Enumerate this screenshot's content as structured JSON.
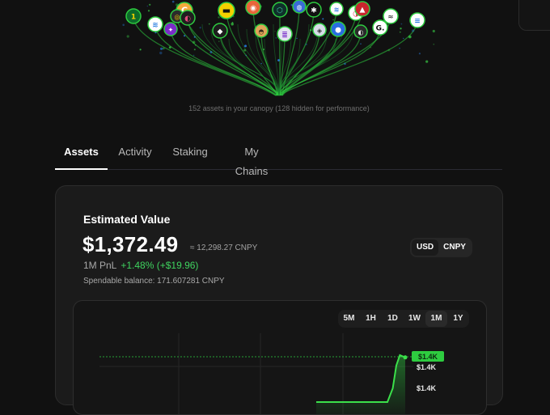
{
  "canopy": {
    "caption": "152 assets in your canopy (128 hidden for performance)",
    "accent_color": "#2ecc40",
    "tokens": [
      {
        "name": "token-icon-1",
        "glyph": "1",
        "bg": "#0d6b2a",
        "fg": "#f5d000"
      },
      {
        "name": "token-icon-2",
        "glyph": "≋",
        "bg": "#ffffff",
        "fg": "#2a7de1"
      },
      {
        "name": "token-icon-3",
        "glyph": "C",
        "bg": "#f2a93b",
        "fg": "#ffffff"
      },
      {
        "name": "token-icon-4",
        "glyph": "◎",
        "bg": "#2b2b2b",
        "fg": "#f7c600"
      },
      {
        "name": "token-icon-5",
        "glyph": "◐",
        "bg": "#1f1f1f",
        "fg": "#e04b7a"
      },
      {
        "name": "token-icon-6",
        "glyph": "✦",
        "bg": "#7b2cc9",
        "fg": "#ffffff"
      },
      {
        "name": "token-icon-7",
        "glyph": "▬",
        "bg": "#f5d000",
        "fg": "#111111"
      },
      {
        "name": "token-icon-8",
        "glyph": "◉",
        "bg": "#e8663a",
        "fg": "#ffffff"
      },
      {
        "name": "token-icon-9",
        "glyph": "⬡",
        "bg": "#0f2f2a",
        "fg": "#3cc9a0"
      },
      {
        "name": "token-icon-10",
        "glyph": "◍",
        "bg": "#3a6bd6",
        "fg": "#ffffff"
      },
      {
        "name": "token-icon-11",
        "glyph": "✱",
        "bg": "#111111",
        "fg": "#ffffff"
      },
      {
        "name": "token-icon-12",
        "glyph": "◓",
        "bg": "#e0a458",
        "fg": "#3a2a1a"
      },
      {
        "name": "token-icon-13",
        "glyph": "◆",
        "bg": "#1d1d1d",
        "fg": "#ffffff"
      },
      {
        "name": "token-icon-14",
        "glyph": "≣",
        "bg": "#e3e3ef",
        "fg": "#7a2cc9"
      },
      {
        "name": "token-icon-15",
        "glyph": "◈",
        "bg": "#d8dde8",
        "fg": "#333333"
      },
      {
        "name": "token-icon-16",
        "glyph": "●",
        "bg": "#2a6de1",
        "fg": "#ffffff"
      },
      {
        "name": "token-icon-17",
        "glyph": "≋",
        "bg": "#ffffff",
        "fg": "#2a7de1"
      },
      {
        "name": "token-icon-18",
        "glyph": "◑",
        "bg": "#ffffff",
        "fg": "#d8364a"
      },
      {
        "name": "token-icon-19",
        "glyph": "▲",
        "bg": "#c9262d",
        "fg": "#ffffff"
      },
      {
        "name": "token-icon-20",
        "glyph": "◐",
        "bg": "#2a2a2a",
        "fg": "#e8e8e8"
      },
      {
        "name": "token-icon-21",
        "glyph": "G.",
        "bg": "#ffffff",
        "fg": "#111111"
      },
      {
        "name": "token-icon-22",
        "glyph": "≈",
        "bg": "#ffffff",
        "fg": "#444444"
      },
      {
        "name": "token-icon-23",
        "glyph": "≡",
        "bg": "#ffffff",
        "fg": "#2a7de1"
      }
    ]
  },
  "tabs": [
    {
      "id": "assets",
      "label": "Assets",
      "active": true
    },
    {
      "id": "activity",
      "label": "Activity",
      "active": false
    },
    {
      "id": "staking",
      "label": "Staking",
      "active": false
    },
    {
      "id": "chains",
      "label": "My Chains",
      "active": false
    }
  ],
  "summary": {
    "title": "Estimated Value",
    "value": "$1,372.49",
    "approx": "≈ 12,298.27 CNPY",
    "pnl_label": "1M PnL",
    "pnl_value": "+1.48% (+$19.96)",
    "spendable": "Spendable balance: 171.607281 CNPY",
    "positive_color": "#3fd35f"
  },
  "currency": {
    "options": [
      "USD",
      "CNPY"
    ],
    "selected": "USD"
  },
  "ranges": {
    "options": [
      "5M",
      "1H",
      "1D",
      "1W",
      "1M",
      "1Y"
    ],
    "selected": "1M"
  },
  "chart_data": {
    "type": "area",
    "x": [
      0,
      0.8,
      0.86,
      0.9,
      0.94,
      0.97,
      1.0
    ],
    "values": [
      1352,
      1352,
      1358,
      1368,
      1372.5,
      1372,
      1371.5
    ],
    "current_label": "$1.4K",
    "y_tick_labels": [
      "$1.4K",
      "$1.4K"
    ],
    "color": "#2ecc40"
  }
}
